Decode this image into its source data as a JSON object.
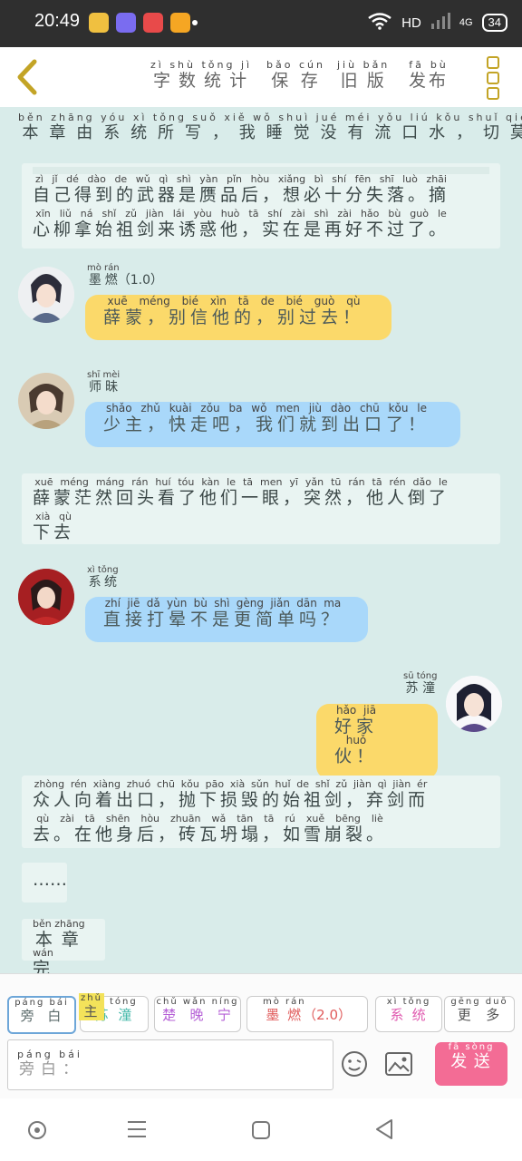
{
  "status_bar": {
    "time": "20:49",
    "network": "HD",
    "cell": "4G",
    "battery": "34"
  },
  "header": {
    "buttons": [
      {
        "text": "字数统计",
        "pinyin": "zì shù tǒng jì"
      },
      {
        "text": "保存",
        "pinyin": "bǎo cún"
      },
      {
        "text": "旧版",
        "pinyin": "jiù bǎn"
      },
      {
        "text": "发布",
        "pinyin": "fā bù"
      }
    ]
  },
  "chat": {
    "top_line": {
      "text": "本章由系统所写，我睡觉没有流口水，切莫听其胡扯！",
      "pinyin": "běn zhāng yóu xì tǒng suǒ xiě   wǒ shuì jué méi yǒu liú kǒu shuǐ   qiē mò tīng qí hú chě"
    },
    "narr1_line1": {
      "text": "自己得到的武器是赝品后，想必十分失落。摘",
      "pinyin": "zì jǐ dé dào de wǔ qì shì yàn pǐn hòu   xiǎng bì shí fēn shī luò   zhāi"
    },
    "narr1_line2": {
      "text": "心柳拿始祖剑来诱惑他，实在是再好不过了。",
      "pinyin": "xīn liǔ ná shǐ zǔ jiàn lái yòu huò tā   shí zài shì zài hǎo bù guò le"
    },
    "msg1": {
      "name": "墨燃",
      "name_pinyin": "mò rán",
      "version": "（1.0）",
      "text": "薛蒙，别信他的，别过去！",
      "pinyin": "xuē méng   bié xìn tā de   bié guò qù"
    },
    "msg2": {
      "name": "师昧",
      "name_pinyin": "shī mèi",
      "text": "少主，快走吧，我们就到出口了！",
      "pinyin": "shǎo zhǔ   kuài zǒu ba   wǒ men jiù dào chū kǒu le"
    },
    "narr2_line1": {
      "text": "薛蒙茫然回头看了他们一眼，突然，他人倒了",
      "pinyin": "xuē méng máng rán huí tóu kàn le tā men yī yǎn   tū rán   tā rén dǎo le"
    },
    "narr2_line2": {
      "text": "下去",
      "pinyin": "xià qù"
    },
    "msg3": {
      "name": "系统",
      "name_pinyin": "xì tǒng",
      "text": "直接打晕不是更简单吗？",
      "pinyin": "zhí jiē dǎ yùn bù shì gèng jiǎn dān ma"
    },
    "msg4": {
      "name": "苏潼",
      "name_pinyin": "sū tóng",
      "text": "好家伙！",
      "pinyin": "hǎo jiā huǒ"
    },
    "narr3_line1": {
      "text": "众人向着出口，抛下损毁的始祖剑，弃剑而",
      "pinyin": "zhòng rén xiàng zhuó chū kǒu   pāo xià sǔn huǐ de shǐ zǔ jiàn   qì jiàn ér"
    },
    "narr3_line2": {
      "text": "去。在他身后，砖瓦坍塌，如雪崩裂。",
      "pinyin": "qù   zài tā shēn hòu   zhuān wǎ tān tā   rú xuě bēng liè"
    },
    "ellipsis": "……",
    "end": {
      "text": "本章完",
      "pinyin": "běn zhāng wán"
    }
  },
  "composer": {
    "roles": [
      {
        "text": "旁白",
        "pinyin": "páng bái",
        "color": "#5b6b6b"
      },
      {
        "text": "苏潼",
        "pinyin": "sū tóng",
        "color": "#40b7a8",
        "badge": "主",
        "badge_pinyin": "zhǔ"
      },
      {
        "text": "楚晚宁",
        "pinyin": "chǔ wǎn níng",
        "color": "#b55fd6"
      },
      {
        "text": "墨燃",
        "pinyin": "mò rán",
        "color": "#e05b5b",
        "suffix": "（2.0）"
      },
      {
        "text": "系统",
        "pinyin": "xì tǒng",
        "color": "#e05bb0"
      },
      {
        "text": "更多",
        "pinyin": "gēng duō",
        "color": "#555555"
      }
    ],
    "input_placeholder": "旁白：",
    "input_placeholder_pinyin": "páng bái",
    "send": {
      "text": "发送",
      "pinyin": "fā sòng"
    }
  }
}
